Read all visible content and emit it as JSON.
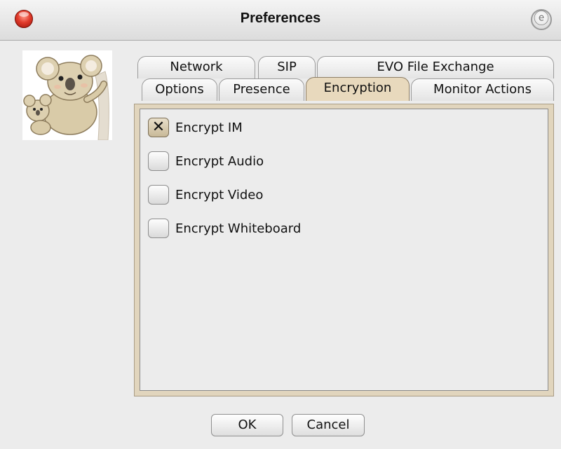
{
  "window": {
    "title": "Preferences"
  },
  "tabs": {
    "row_back": [
      {
        "label": "Network"
      },
      {
        "label": "SIP"
      },
      {
        "label": "EVO File Exchange"
      }
    ],
    "row_front": [
      {
        "label": "Options"
      },
      {
        "label": "Presence"
      },
      {
        "label": "Encryption",
        "active": true
      },
      {
        "label": "Monitor Actions"
      }
    ]
  },
  "encryption": {
    "options": [
      {
        "label": "Encrypt IM",
        "checked": true
      },
      {
        "label": "Encrypt Audio",
        "checked": false
      },
      {
        "label": "Encrypt Video",
        "checked": false
      },
      {
        "label": "Encrypt Whiteboard",
        "checked": false
      }
    ]
  },
  "buttons": {
    "ok": "OK",
    "cancel": "Cancel"
  },
  "icons": {
    "close": "close-icon",
    "title_right": "e-icon",
    "avatar": "koala-icon"
  },
  "colors": {
    "active_tab": "#e8d9bd",
    "close_button": "#e23c2c",
    "window_bg": "#ececec"
  }
}
